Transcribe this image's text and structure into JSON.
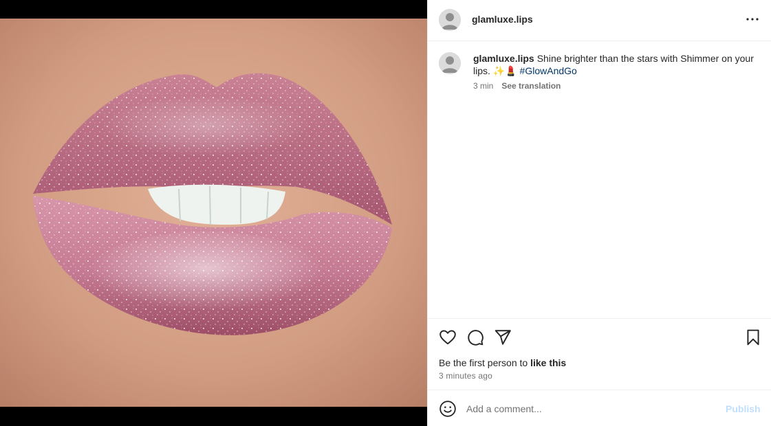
{
  "post": {
    "username": "glamluxe.lips",
    "caption_text": "Shine brighter than the stars with Shimmer on your lips. ✨💄",
    "hashtag": "#GlowAndGo",
    "caption_time": "3 min",
    "see_translation": "See translation"
  },
  "icons": {
    "more": "more-options-icon",
    "like": "heart-icon",
    "comment": "comment-icon",
    "share": "paper-plane-icon",
    "save": "bookmark-icon",
    "emoji": "smiley-icon",
    "avatar": "default-avatar-icon"
  },
  "engagement": {
    "likes_prefix": "Be the first person to ",
    "likes_action": "like this",
    "timestamp": "3 minutes ago"
  },
  "comment_box": {
    "placeholder": "Add a comment...",
    "publish_label": "Publish"
  },
  "colors": {
    "hashtag": "#00376b",
    "publish_disabled": "#c0dffd",
    "secondary_text": "#737373",
    "divider": "#efefef"
  }
}
